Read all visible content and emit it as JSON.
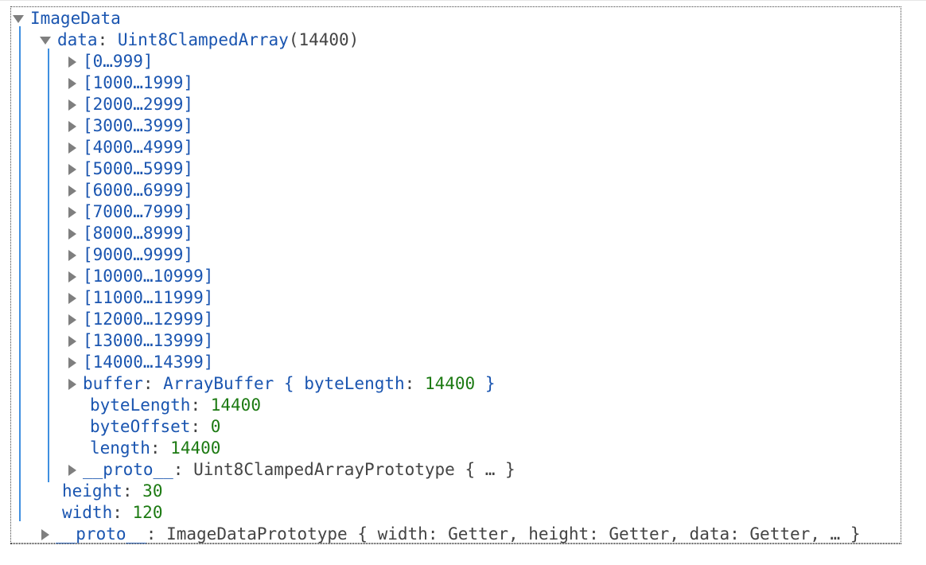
{
  "root": {
    "label": "ImageData"
  },
  "data_node": {
    "key": "data",
    "type": "Uint8ClampedArray",
    "count": "(14400)",
    "colon": ":"
  },
  "ranges": [
    "[0…999]",
    "[1000…1999]",
    "[2000…2999]",
    "[3000…3999]",
    "[4000…4999]",
    "[5000…5999]",
    "[6000…6999]",
    "[7000…7999]",
    "[8000…8999]",
    "[9000…9999]",
    "[10000…10999]",
    "[11000…11999]",
    "[12000…12999]",
    "[13000…13999]",
    "[14000…14399]"
  ],
  "buffer": {
    "key": "buffer",
    "type": "ArrayBuffer",
    "open": "{",
    "inner_key": "byteLength",
    "inner_value": "14400",
    "close": "}"
  },
  "byteLength": {
    "key": "byteLength",
    "value": "14400"
  },
  "byteOffset": {
    "key": "byteOffset",
    "value": "0"
  },
  "length": {
    "key": "length",
    "value": "14400"
  },
  "data_proto": {
    "key": "__proto__",
    "value": "Uint8ClampedArrayPrototype { … }"
  },
  "height": {
    "key": "height",
    "value": "30"
  },
  "width": {
    "key": "width",
    "value": "120"
  },
  "root_proto": {
    "key": "__proto__",
    "value": "ImageDataPrototype { width: Getter, height: Getter, data: Getter, … }"
  }
}
